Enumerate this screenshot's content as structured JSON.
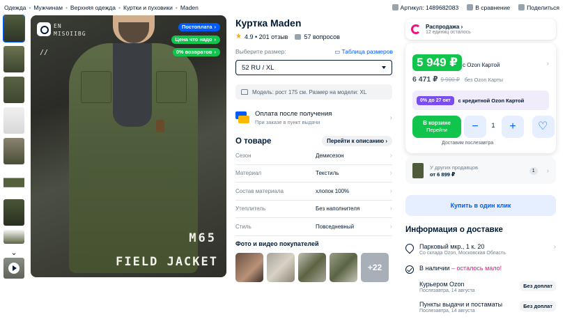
{
  "breadcrumb": [
    "Одежда",
    "Мужчинам",
    "Верхняя одежда",
    "Куртки и пуховики",
    "Maden"
  ],
  "header_actions": {
    "article": "Артикул: 1489682083",
    "compare": "В сравнение",
    "share": "Поделиться"
  },
  "gallery": {
    "badges": [
      "Постоплата",
      "Цена что надо",
      "0% возвратов"
    ],
    "brand_text": "EN\nMISOIIBG",
    "slashes": "//",
    "overlay_line1": "M65",
    "overlay_line2": "FIELD JACKET"
  },
  "product": {
    "title": "Куртка Maden",
    "rating": "4.9 • 201 отзыв",
    "questions": "57 вопросов",
    "size_label": "Выберите размер:",
    "size_table": "Таблица размеров",
    "size_value": "52 RU / XL",
    "model_info": "Модель: рост 175 см. Размер на модели: XL",
    "payment_title": "Оплата после получения",
    "payment_sub": "При заказе в пункт выдачи",
    "about_title": "О товаре",
    "about_button": "Перейти к описанию",
    "properties": [
      {
        "key": "Сезон",
        "value": "Демисезон"
      },
      {
        "key": "Материал",
        "value": "Текстиль"
      },
      {
        "key": "Состав материала",
        "value": "хлопок 100%"
      },
      {
        "key": "Утеплитель",
        "value": "Без наполнителя"
      },
      {
        "key": "Стиль",
        "value": "Повседневный"
      }
    ],
    "photos_title": "Фото и видео покупателей",
    "photos_more": "+22"
  },
  "buybox": {
    "sale_title": "Распродажа",
    "sale_sub": "12 единиц осталось",
    "price_card": "5 949 ₽",
    "price_card_label": "с Ozon Картой",
    "price_regular": "6 471 ₽",
    "price_old": "9 900 ₽",
    "price_regular_label": "без Ozon Карты",
    "credit_pill": "0% до 27 окт",
    "credit_text": "с кредитной Ozon Картой",
    "cart_label": "В корзине",
    "cart_sub": "Перейти",
    "qty": "1",
    "delivery_note": "Доставим послезавтра",
    "others_title": "У других продавцов",
    "others_price": "от 6 899 ₽",
    "others_count": "1",
    "one_click": "Купить в один клик"
  },
  "delivery": {
    "title": "Информация о доставке",
    "address": "Парковый мкр., 1 к. 20",
    "address_sub": "Со склада Ozon, Московская Область",
    "stock": "В наличии",
    "stock_warn": "– осталось мало!",
    "courier": "Курьером Ozon",
    "courier_date": "Послезавтра, 14 августа",
    "courier_price": "Без доплат",
    "pickup": "Пункты выдачи и постаматы",
    "pickup_date": "Послезавтра, 14 августа",
    "pickup_price": "Без доплат"
  },
  "colors": {
    "ozon_blue": "#005bff",
    "green": "#10c44c",
    "purple": "#7a4df0",
    "sale_pink": "#f1117e"
  }
}
